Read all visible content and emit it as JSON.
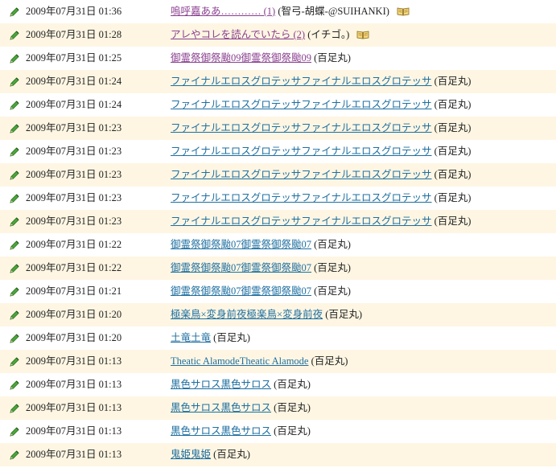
{
  "entries": [
    {
      "time": "2009年07月31日 01:36",
      "title": "嗚呼嘉ああ………… (1)",
      "author": "(智弓-胡蝶-@SUIHANKI)",
      "visited": true,
      "book": true
    },
    {
      "time": "2009年07月31日 01:28",
      "title": "アレやコレを読んでいたら (2)",
      "author": "(イチゴ。)",
      "visited": true,
      "book": true
    },
    {
      "time": "2009年07月31日 01:25",
      "title": "御霊祭御祭颱09御霊祭御祭颱09",
      "author": "(百足丸)",
      "visited": true,
      "book": false
    },
    {
      "time": "2009年07月31日 01:24",
      "title": "ファイナルエロスグロテッサファイナルエロスグロテッサ",
      "author": "(百足丸)",
      "visited": false,
      "book": false
    },
    {
      "time": "2009年07月31日 01:24",
      "title": "ファイナルエロスグロテッサファイナルエロスグロテッサ",
      "author": "(百足丸)",
      "visited": false,
      "book": false
    },
    {
      "time": "2009年07月31日 01:23",
      "title": "ファイナルエロスグロテッサファイナルエロスグロテッサ",
      "author": "(百足丸)",
      "visited": false,
      "book": false
    },
    {
      "time": "2009年07月31日 01:23",
      "title": "ファイナルエロスグロテッサファイナルエロスグロテッサ",
      "author": "(百足丸)",
      "visited": false,
      "book": false
    },
    {
      "time": "2009年07月31日 01:23",
      "title": "ファイナルエロスグロテッサファイナルエロスグロテッサ",
      "author": "(百足丸)",
      "visited": false,
      "book": false
    },
    {
      "time": "2009年07月31日 01:23",
      "title": "ファイナルエロスグロテッサファイナルエロスグロテッサ",
      "author": "(百足丸)",
      "visited": false,
      "book": false
    },
    {
      "time": "2009年07月31日 01:23",
      "title": "ファイナルエロスグロテッサファイナルエロスグロテッサ",
      "author": "(百足丸)",
      "visited": false,
      "book": false
    },
    {
      "time": "2009年07月31日 01:22",
      "title": "御霊祭御祭颱07御霊祭御祭颱07",
      "author": "(百足丸)",
      "visited": false,
      "book": false
    },
    {
      "time": "2009年07月31日 01:22",
      "title": "御霊祭御祭颱07御霊祭御祭颱07",
      "author": "(百足丸)",
      "visited": false,
      "book": false
    },
    {
      "time": "2009年07月31日 01:21",
      "title": "御霊祭御祭颱07御霊祭御祭颱07",
      "author": "(百足丸)",
      "visited": false,
      "book": false
    },
    {
      "time": "2009年07月31日 01:20",
      "title": "極楽鳥×変身前夜極楽鳥×変身前夜",
      "author": "(百足丸)",
      "visited": false,
      "book": false
    },
    {
      "time": "2009年07月31日 01:20",
      "title": "土竜土竜",
      "author": "(百足丸)",
      "visited": false,
      "book": false
    },
    {
      "time": "2009年07月31日 01:13",
      "title": "Theatic AlamodeTheatic Alamode",
      "author": "(百足丸)",
      "visited": false,
      "book": false
    },
    {
      "time": "2009年07月31日 01:13",
      "title": "黒色サロス黒色サロス",
      "author": "(百足丸)",
      "visited": false,
      "book": false
    },
    {
      "time": "2009年07月31日 01:13",
      "title": "黒色サロス黒色サロス",
      "author": "(百足丸)",
      "visited": false,
      "book": false
    },
    {
      "time": "2009年07月31日 01:13",
      "title": "黒色サロス黒色サロス",
      "author": "(百足丸)",
      "visited": false,
      "book": false
    },
    {
      "time": "2009年07月31日 01:13",
      "title": "鬼姫鬼姫",
      "author": "(百足丸)",
      "visited": false,
      "book": false
    }
  ],
  "icons": {
    "row_icon": "pencil-icon",
    "book_icon": "open-book-icon"
  },
  "colors": {
    "row_alt_bg": "#fef6e3",
    "visited_link": "#8a3f8f",
    "unvisited_link": "#1e6fa0",
    "pencil_green": "#3f9a2e"
  }
}
